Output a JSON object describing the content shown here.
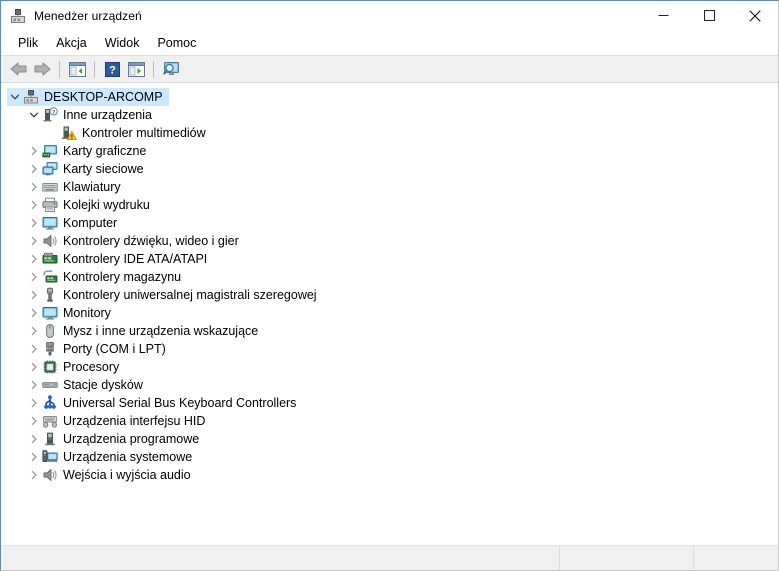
{
  "window": {
    "title": "Menedżer urządzeń",
    "title_icon": "device-manager-icon",
    "minimize_label": "—",
    "maximize_label": "□",
    "close_label": "✕"
  },
  "menubar": {
    "items": [
      {
        "label": "Plik",
        "name": "menu-file"
      },
      {
        "label": "Akcja",
        "name": "menu-action"
      },
      {
        "label": "Widok",
        "name": "menu-view"
      },
      {
        "label": "Pomoc",
        "name": "menu-help"
      }
    ]
  },
  "toolbar": {
    "buttons": [
      {
        "name": "back-button",
        "icon": "back-arrow-icon",
        "tooltip": "Wstecz"
      },
      {
        "name": "forward-button",
        "icon": "forward-arrow-icon",
        "tooltip": "Dalej"
      },
      {
        "name": "show-hide-console-tree-button",
        "icon": "console-tree-icon",
        "tooltip": "Pokaż/Ukryj drzewo konsoli"
      },
      {
        "name": "help-button",
        "icon": "help-question-icon",
        "tooltip": "Pomoc"
      },
      {
        "name": "properties-button",
        "icon": "properties-panel-icon",
        "tooltip": "Właściwości"
      },
      {
        "name": "scan-hardware-changes-button",
        "icon": "scan-monitor-icon",
        "tooltip": "Skanuj w poszukiwaniu zmian sprzętu"
      }
    ]
  },
  "tree": {
    "root": {
      "label": "DESKTOP-ARCOMP",
      "icon": "computer-node-icon",
      "expanded": true,
      "selected": true,
      "level": 0
    },
    "nodes": [
      {
        "label": "Inne urządzenia",
        "icon": "unknown-device-icon",
        "level": 1,
        "expanded": true,
        "has_children": true
      },
      {
        "label": "Kontroler multimediów",
        "icon": "warning-device-icon",
        "level": 2,
        "expanded": false,
        "has_children": false
      },
      {
        "label": "Karty graficzne",
        "icon": "display-adapter-icon",
        "level": 1,
        "expanded": false,
        "has_children": true
      },
      {
        "label": "Karty sieciowe",
        "icon": "network-adapter-icon",
        "level": 1,
        "expanded": false,
        "has_children": true
      },
      {
        "label": "Klawiatury",
        "icon": "keyboard-icon",
        "level": 1,
        "expanded": false,
        "has_children": true
      },
      {
        "label": "Kolejki wydruku",
        "icon": "printer-icon",
        "level": 1,
        "expanded": false,
        "has_children": true
      },
      {
        "label": "Komputer",
        "icon": "computer-icon",
        "level": 1,
        "expanded": false,
        "has_children": true
      },
      {
        "label": "Kontrolery dźwięku, wideo i gier",
        "icon": "sound-icon",
        "level": 1,
        "expanded": false,
        "has_children": true
      },
      {
        "label": "Kontrolery IDE ATA/ATAPI",
        "icon": "ide-controller-icon",
        "level": 1,
        "expanded": false,
        "has_children": true
      },
      {
        "label": "Kontrolery magazynu",
        "icon": "storage-controller-icon",
        "level": 1,
        "expanded": false,
        "has_children": true
      },
      {
        "label": "Kontrolery uniwersalnej magistrali szeregowej",
        "icon": "usb-controller-icon",
        "level": 1,
        "expanded": false,
        "has_children": true
      },
      {
        "label": "Monitory",
        "icon": "monitor-icon",
        "level": 1,
        "expanded": false,
        "has_children": true
      },
      {
        "label": "Mysz i inne urządzenia wskazujące",
        "icon": "mouse-icon",
        "level": 1,
        "expanded": false,
        "has_children": true
      },
      {
        "label": "Porty (COM i LPT)",
        "icon": "port-icon",
        "level": 1,
        "expanded": false,
        "has_children": true
      },
      {
        "label": "Procesory",
        "icon": "processor-icon",
        "level": 1,
        "expanded": false,
        "has_children": true
      },
      {
        "label": "Stacje dysków",
        "icon": "disk-drive-icon",
        "level": 1,
        "expanded": false,
        "has_children": true
      },
      {
        "label": "Universal Serial Bus Keyboard Controllers",
        "icon": "usb-keyboard-controller-icon",
        "level": 1,
        "expanded": false,
        "has_children": true
      },
      {
        "label": "Urządzenia interfejsu HID",
        "icon": "hid-device-icon",
        "level": 1,
        "expanded": false,
        "has_children": true
      },
      {
        "label": "Urządzenia programowe",
        "icon": "software-device-icon",
        "level": 1,
        "expanded": false,
        "has_children": true
      },
      {
        "label": "Urządzenia systemowe",
        "icon": "system-device-icon",
        "level": 1,
        "expanded": false,
        "has_children": true
      },
      {
        "label": "Wejścia i wyjścia audio",
        "icon": "audio-io-icon",
        "level": 1,
        "expanded": false,
        "has_children": true
      }
    ]
  },
  "statusbar": {
    "panel1": "",
    "panel2": "",
    "panel3": ""
  },
  "colors": {
    "selection": "#cce8ff",
    "accent_border": "#4a94b8",
    "toolbar_bg": "#f0f0f0",
    "statusbar_bg": "#f0f0f0",
    "warning": "#ffc20e"
  }
}
